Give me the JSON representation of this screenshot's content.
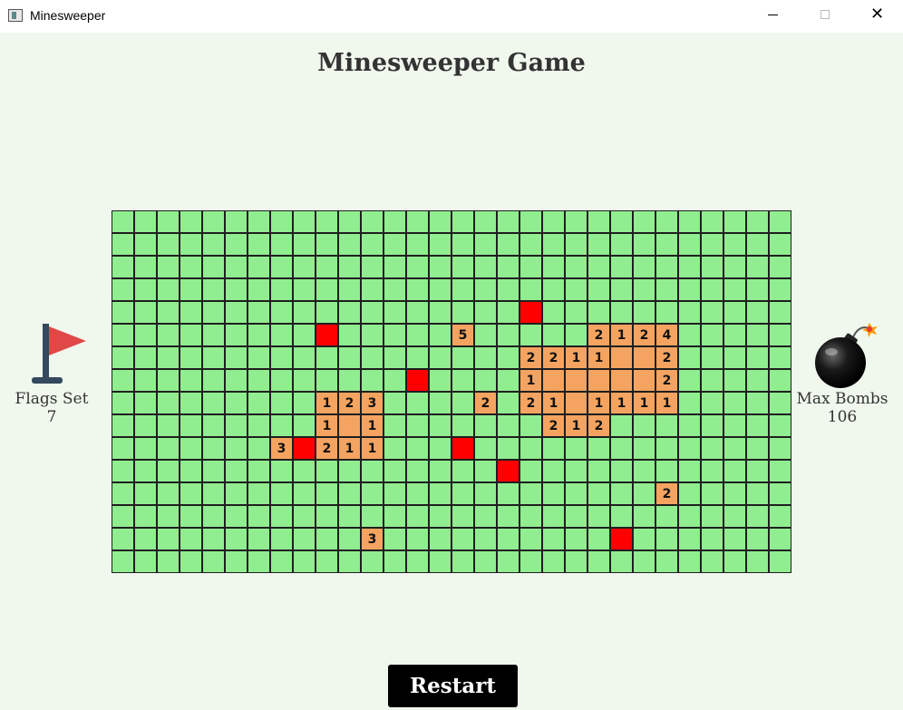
{
  "window": {
    "title": "Minesweeper",
    "close_glyph": "✕"
  },
  "header": {
    "title": "Minesweeper Game"
  },
  "flags": {
    "label": "Flags Set",
    "value": "7",
    "icon": "flag-icon"
  },
  "bombs": {
    "label": "Max Bombs",
    "value": "106",
    "icon": "bomb-icon"
  },
  "restart": {
    "label": "Restart"
  },
  "board": {
    "rows": 16,
    "cols": 30,
    "legend": {
      "#": "covered",
      ".": "revealed-empty",
      "F": "flagged",
      "1-8": "revealed-count"
    },
    "grid": [
      "##############################",
      "##############################",
      "##############################",
      "##############################",
      "##############################",
      "##############################",
      "##############################",
      "##############################",
      "##############################",
      "##############################",
      "##############################",
      "##############################",
      "##############################",
      "##############################",
      "##############################",
      "##############################"
    ],
    "colors": {
      "covered": "#90ee90",
      "revealed": "#f4a460",
      "flagged": "#ff0000",
      "border": "#1f1f1f"
    }
  }
}
